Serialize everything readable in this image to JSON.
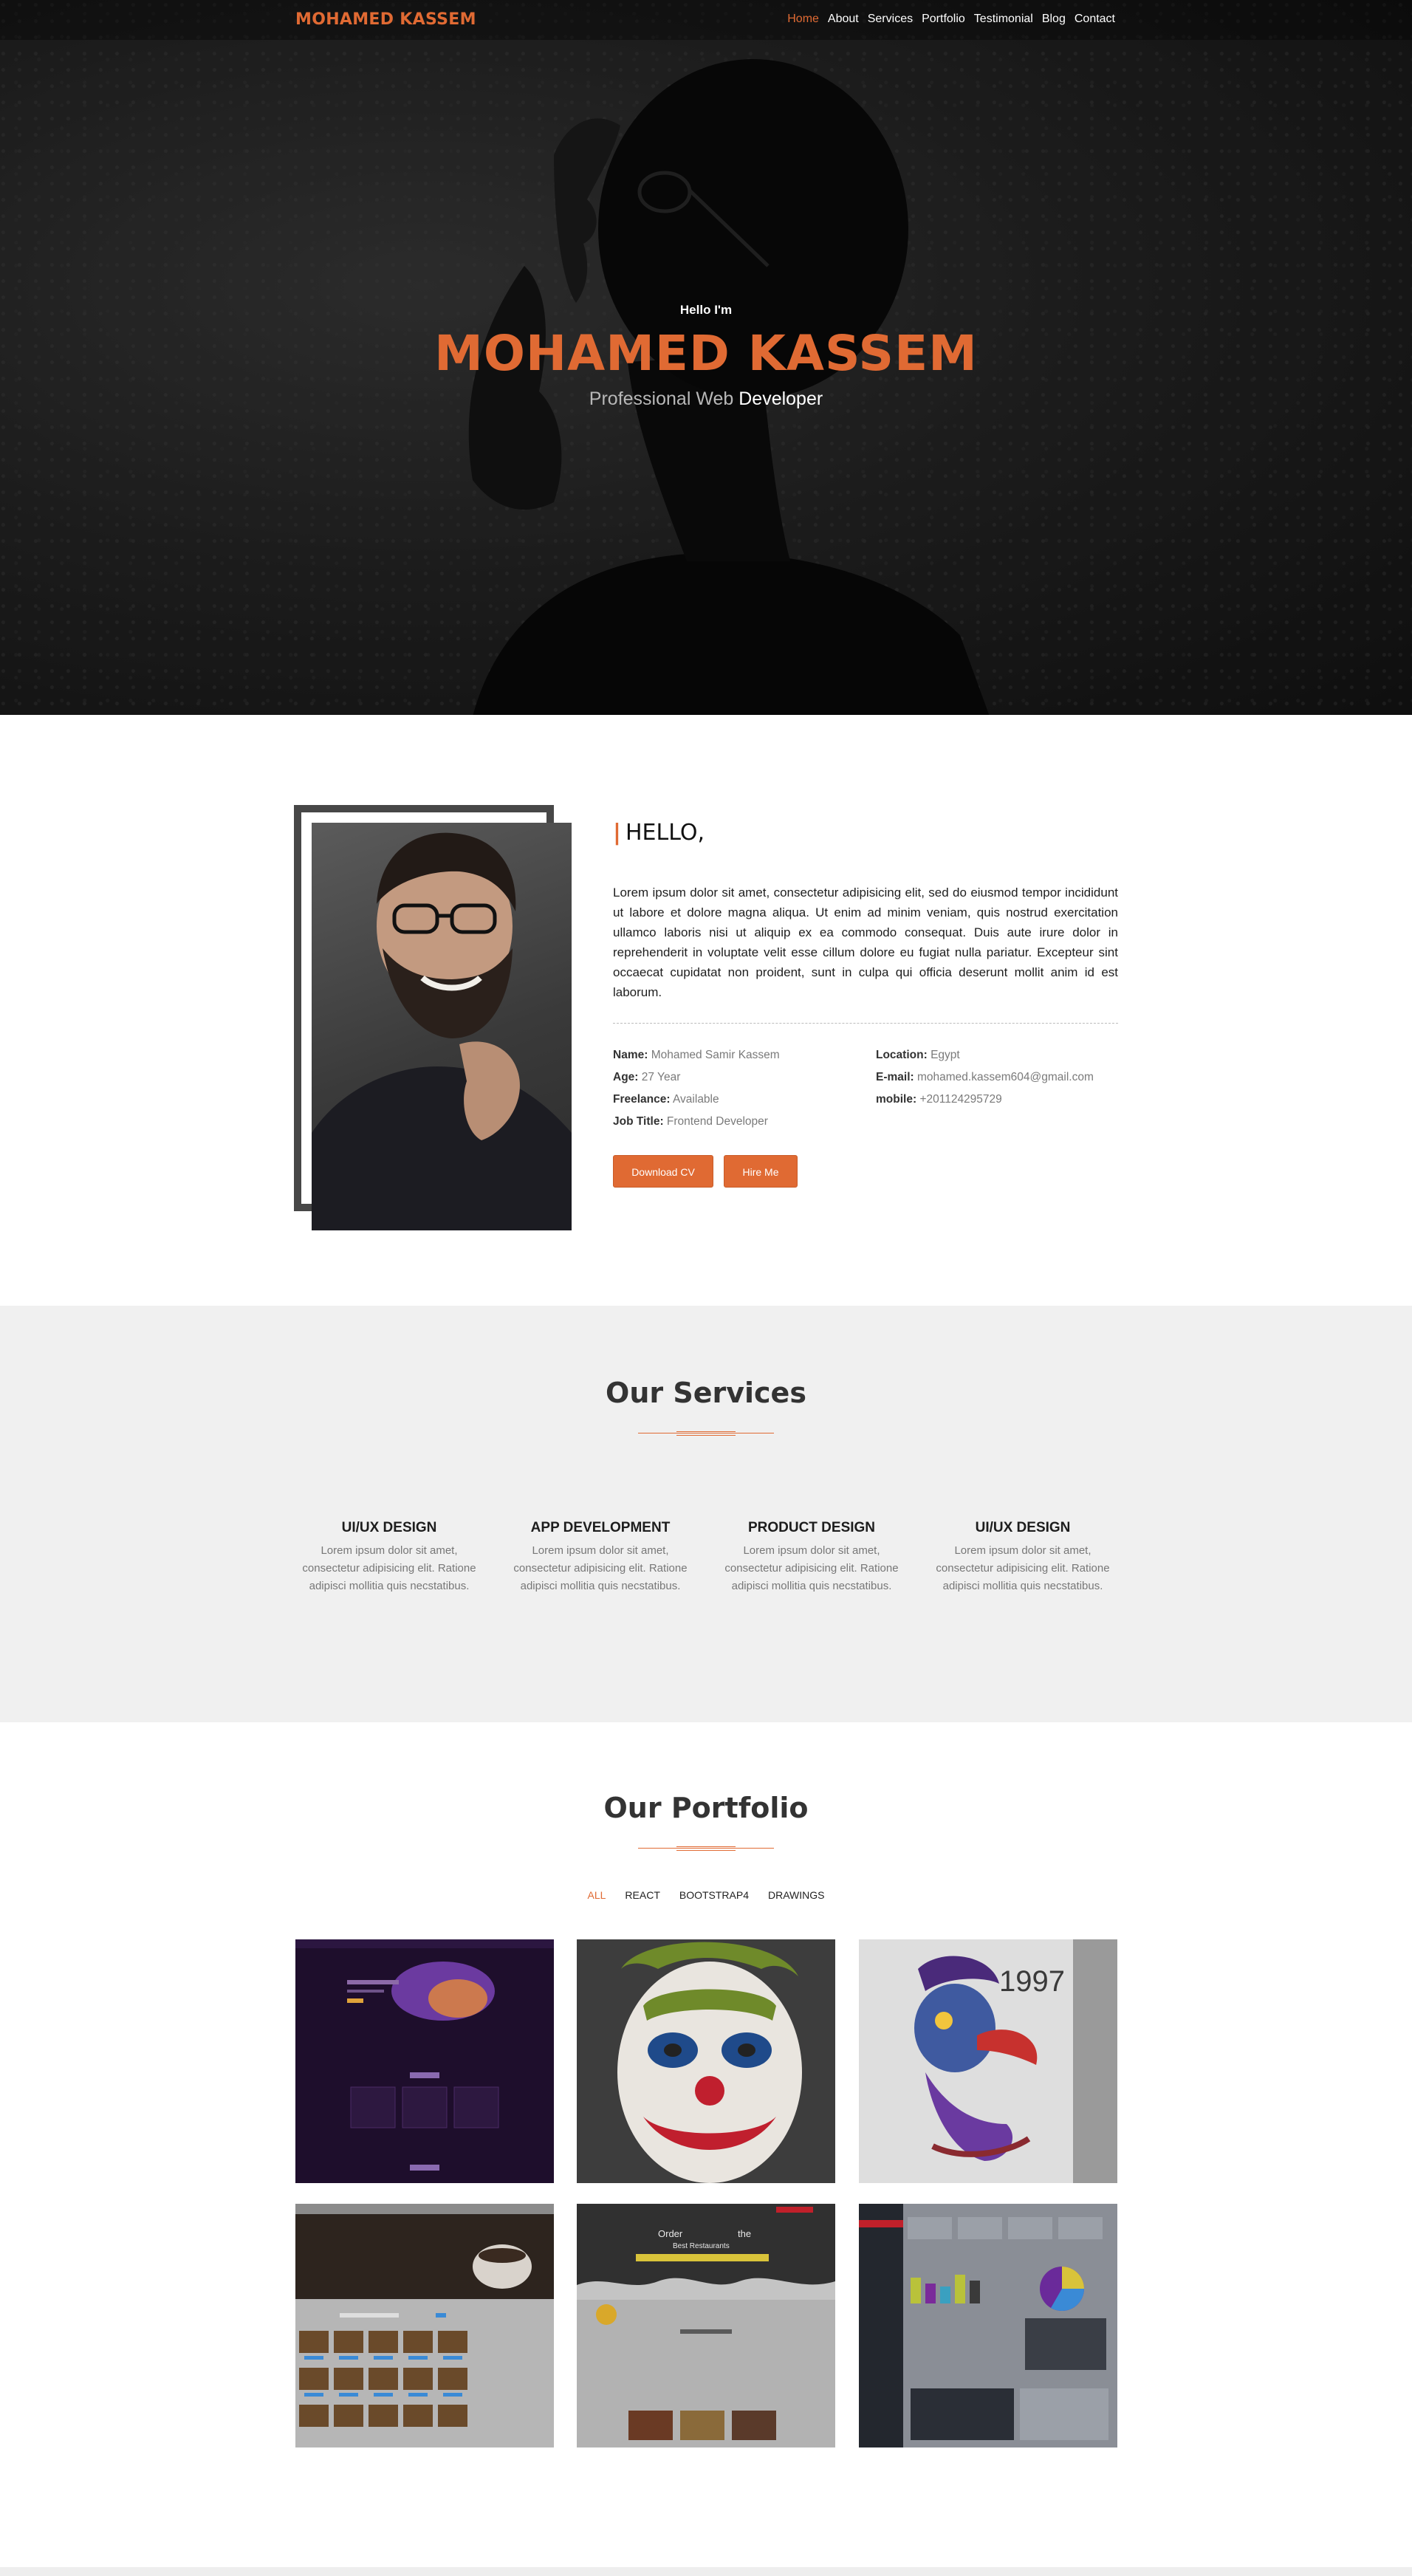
{
  "nav": {
    "brand": "MOHAMED KASSEM",
    "links": [
      "Home",
      "About",
      "Services",
      "Portfolio",
      "Testimonial",
      "Blog",
      "Contact"
    ]
  },
  "hero": {
    "hello": "Hello I'm",
    "name": "MOHAMED KASSEM",
    "subtitle_prefix": "Professional Web",
    "subtitle_highlight": "Developer"
  },
  "about": {
    "title": "HELLO,",
    "paragraph": "Lorem ipsum dolor sit amet, consectetur adipisicing elit, sed do eiusmod tempor incididunt ut labore et dolore magna aliqua. Ut enim ad minim veniam, quis nostrud exercitation ullamco laboris nisi ut aliquip ex ea commodo consequat. Duis aute irure dolor in reprehenderit in voluptate velit esse cillum dolore eu fugiat nulla pariatur. Excepteur sint occaecat cupidatat non proident, sunt in culpa qui officia deserunt mollit anim id est laborum.",
    "info": [
      {
        "key": "Name:",
        "value": "Mohamed Samir Kassem"
      },
      {
        "key": "Location:",
        "value": "Egypt"
      },
      {
        "key": "Age:",
        "value": "27 Year"
      },
      {
        "key": "E-mail:",
        "value": "mohamed.kassem604@gmail.com"
      },
      {
        "key": "Freelance:",
        "value": "Available"
      },
      {
        "key": "mobile:",
        "value": "+201124295729"
      },
      {
        "key": "Job Title:",
        "value": "Frontend Developer"
      }
    ],
    "download_label": "Download CV",
    "hire_label": "Hire Me"
  },
  "services": {
    "title": "Our Services",
    "items": [
      {
        "title": "UI/UX DESIGN",
        "text": "Lorem ipsum dolor sit amet, consectetur adipisicing elit. Ratione adipisci mollitia quis necstatibus."
      },
      {
        "title": "APP DEVELOPMENT",
        "text": "Lorem ipsum dolor sit amet, consectetur adipisicing elit. Ratione adipisci mollitia quis necstatibus."
      },
      {
        "title": "PRODUCT DESIGN",
        "text": "Lorem ipsum dolor sit amet, consectetur adipisicing elit. Ratione adipisci mollitia quis necstatibus."
      },
      {
        "title": "UI/UX DESIGN",
        "text": "Lorem ipsum dolor sit amet, consectetur adipisicing elit. Ratione adipisci mollitia quis necstatibus."
      }
    ]
  },
  "portfolio": {
    "title": "Our Portfolio",
    "filters": [
      "ALL",
      "REACT",
      "BOOTSTRAP4",
      "DRAWINGS"
    ],
    "tiles": [
      "website-preview",
      "joker-drawing",
      "pirate-parrot-drawing",
      "food-website-preview",
      "restaurant-website-preview",
      "dashboard-preview"
    ],
    "tile_texts": {
      "year": "1997",
      "restaurant_heading_a": "Order",
      "restaurant_heading_b": "the",
      "restaurant_heading_c": "Best Restaurants"
    }
  },
  "colors": {
    "accent": "#e06a33",
    "dark": "#333333",
    "muted": "#777777",
    "services_bg": "#f0f0f0"
  }
}
